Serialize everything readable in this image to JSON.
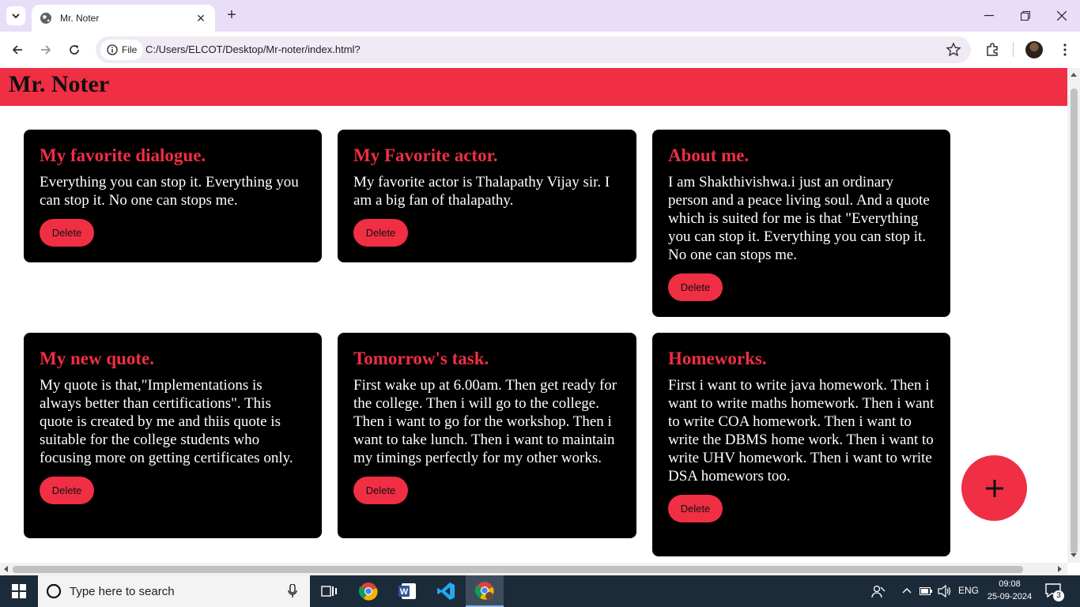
{
  "browser": {
    "tab_title": "Mr. Noter",
    "site_chip": "File",
    "url": "C:/Users/ELCOT/Desktop/Mr-noter/index.html?"
  },
  "app": {
    "title": "Mr. Noter",
    "accent_color": "#f02e44",
    "card_color": "#000000",
    "add_button_icon": "plus-icon"
  },
  "notes": [
    {
      "title": "My favorite dialogue.",
      "body": "Everything you can stop it. Everything you can stop it. No one can stops me.",
      "delete_label": "Delete"
    },
    {
      "title": "My Favorite actor.",
      "body": "My favorite actor is Thalapathy Vijay sir. I am a big fan of thalapathy.",
      "delete_label": "Delete"
    },
    {
      "title": "About me.",
      "body": "I am Shakthivishwa.i just an ordinary person and a peace living soul. And a quote which is suited for me is that \"Everything you can stop it. Everything you can stop it. No one can stops me.",
      "delete_label": "Delete"
    },
    {
      "title": "My new quote.",
      "body": "My quote is that,\"Implementations is always better than certifications\". This quote is created by me and thiis quote is suitable for the college students who focusing more on getting certificates only.",
      "delete_label": "Delete"
    },
    {
      "title": "Tomorrow's task.",
      "body": "First wake up at 6.00am. Then get ready for the college. Then i will go to the college. Then i want to go for the workshop. Then i want to take lunch. Then i want to maintain my timings perfectly for my other works.",
      "delete_label": "Delete"
    },
    {
      "title": "Homeworks.",
      "body": "First i want to write java homework. Then i want to write maths homework. Then i want to write COA homework. Then i want to write the DBMS home work. Then i want to write UHV homework. Then i want to write DSA homewors too.",
      "delete_label": "Delete"
    }
  ],
  "taskbar": {
    "search_placeholder": "Type here to search",
    "language": "ENG",
    "time": "09:08",
    "date": "25-09-2024",
    "notification_count": "3"
  }
}
